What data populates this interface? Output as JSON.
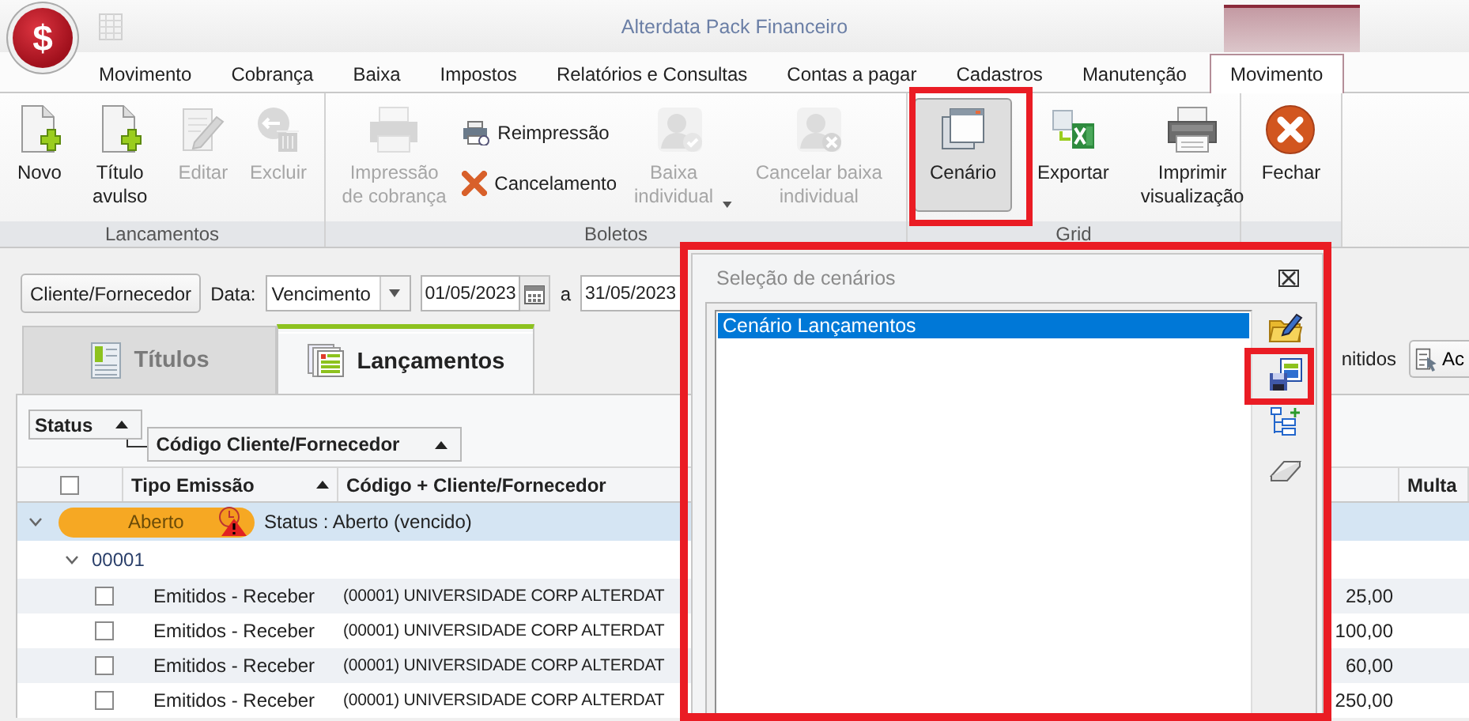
{
  "window": {
    "logo": "$",
    "title": "Alterdata Pack Financeiro"
  },
  "menu_tabs": [
    {
      "label": "Movimento",
      "selected": false
    },
    {
      "label": "Cobrança",
      "selected": false
    },
    {
      "label": "Baixa",
      "selected": false
    },
    {
      "label": "Impostos",
      "selected": false
    },
    {
      "label": "Relatórios e Consultas",
      "selected": false
    },
    {
      "label": "Contas a pagar",
      "selected": false
    },
    {
      "label": "Cadastros",
      "selected": false
    },
    {
      "label": "Manutenção",
      "selected": false
    },
    {
      "label": "Movimento",
      "selected": true
    }
  ],
  "ribbon": {
    "groups": [
      {
        "title": "Lancamentos",
        "buttons": [
          {
            "label": "Novo",
            "kind": "large",
            "disabled": false,
            "pressed": false
          },
          {
            "label": "Título avulso",
            "kind": "large",
            "disabled": false,
            "pressed": false
          },
          {
            "label": "Editar",
            "kind": "large",
            "disabled": true,
            "pressed": false
          },
          {
            "label": "Excluir",
            "kind": "large",
            "disabled": true,
            "pressed": false
          }
        ]
      },
      {
        "title": "Boletos",
        "buttons": [
          {
            "label": "Impressão de cobrança",
            "kind": "large",
            "disabled": true,
            "pressed": false
          },
          {
            "label": "Reimpressão",
            "kind": "small",
            "disabled": false,
            "pressed": false
          },
          {
            "label": "Cancelamento",
            "kind": "small",
            "disabled": false,
            "pressed": false
          },
          {
            "label": "Baixa individual",
            "kind": "dropdown",
            "disabled": true,
            "pressed": false
          },
          {
            "label": "Cancelar baixa individual",
            "kind": "large",
            "disabled": true,
            "pressed": false
          }
        ]
      },
      {
        "title": "Grid",
        "buttons": [
          {
            "label": "Cenário",
            "kind": "large",
            "disabled": false,
            "pressed": true
          },
          {
            "label": "Exportar",
            "kind": "large",
            "disabled": false,
            "pressed": false
          },
          {
            "label": "Imprimir visualização",
            "kind": "large",
            "disabled": false,
            "pressed": false
          }
        ]
      },
      {
        "buttons": [
          {
            "label": "Fechar",
            "kind": "large",
            "disabled": false,
            "pressed": false
          }
        ]
      }
    ]
  },
  "filter": {
    "button": "Cliente/Fornecedor",
    "date_label": "Data:",
    "date_type": "Vencimento",
    "date_from": "01/05/2023",
    "separator": "a",
    "date_to": "31/05/2023"
  },
  "tabs": [
    {
      "label": "Títulos",
      "selected": false
    },
    {
      "label": "Lançamentos",
      "selected": true
    }
  ],
  "right_tools": {
    "text": "nitidos",
    "button": "Ac"
  },
  "group_by": [
    {
      "label": "Status"
    },
    {
      "label": "Código Cliente/Fornecedor"
    }
  ],
  "table": {
    "header_checked": false,
    "columns": [
      {
        "label": "Tipo Emissão",
        "sorted": true
      },
      {
        "label": "Código + Cliente/Fornecedor"
      },
      {
        "label": "Multa"
      }
    ],
    "group": {
      "badge": "Aberto",
      "text": "Status : Aberto (vencido)",
      "expanded": true,
      "subgroups": [
        {
          "label": "00001",
          "expanded": true,
          "rows": [
            {
              "checked": false,
              "tipo_emissao": "Emitidos - Receber",
              "cliente": "(00001) UNIVERSIDADE CORP ALTERDAT",
              "column_4": "25,00"
            },
            {
              "checked": false,
              "tipo_emissao": "Emitidos - Receber",
              "cliente": "(00001) UNIVERSIDADE CORP ALTERDAT",
              "column_4": "100,00"
            },
            {
              "checked": false,
              "tipo_emissao": "Emitidos - Receber",
              "cliente": "(00001) UNIVERSIDADE CORP ALTERDAT",
              "column_4": "60,00"
            },
            {
              "checked": false,
              "tipo_emissao": "Emitidos - Receber",
              "cliente": "(00001) UNIVERSIDADE CORP ALTERDAT",
              "column_4": "250,00"
            }
          ]
        }
      ]
    }
  },
  "dialog": {
    "title": "Seleção de cenários",
    "items": [
      {
        "label": "Cenário Lançamentos",
        "selected": true
      }
    ]
  }
}
